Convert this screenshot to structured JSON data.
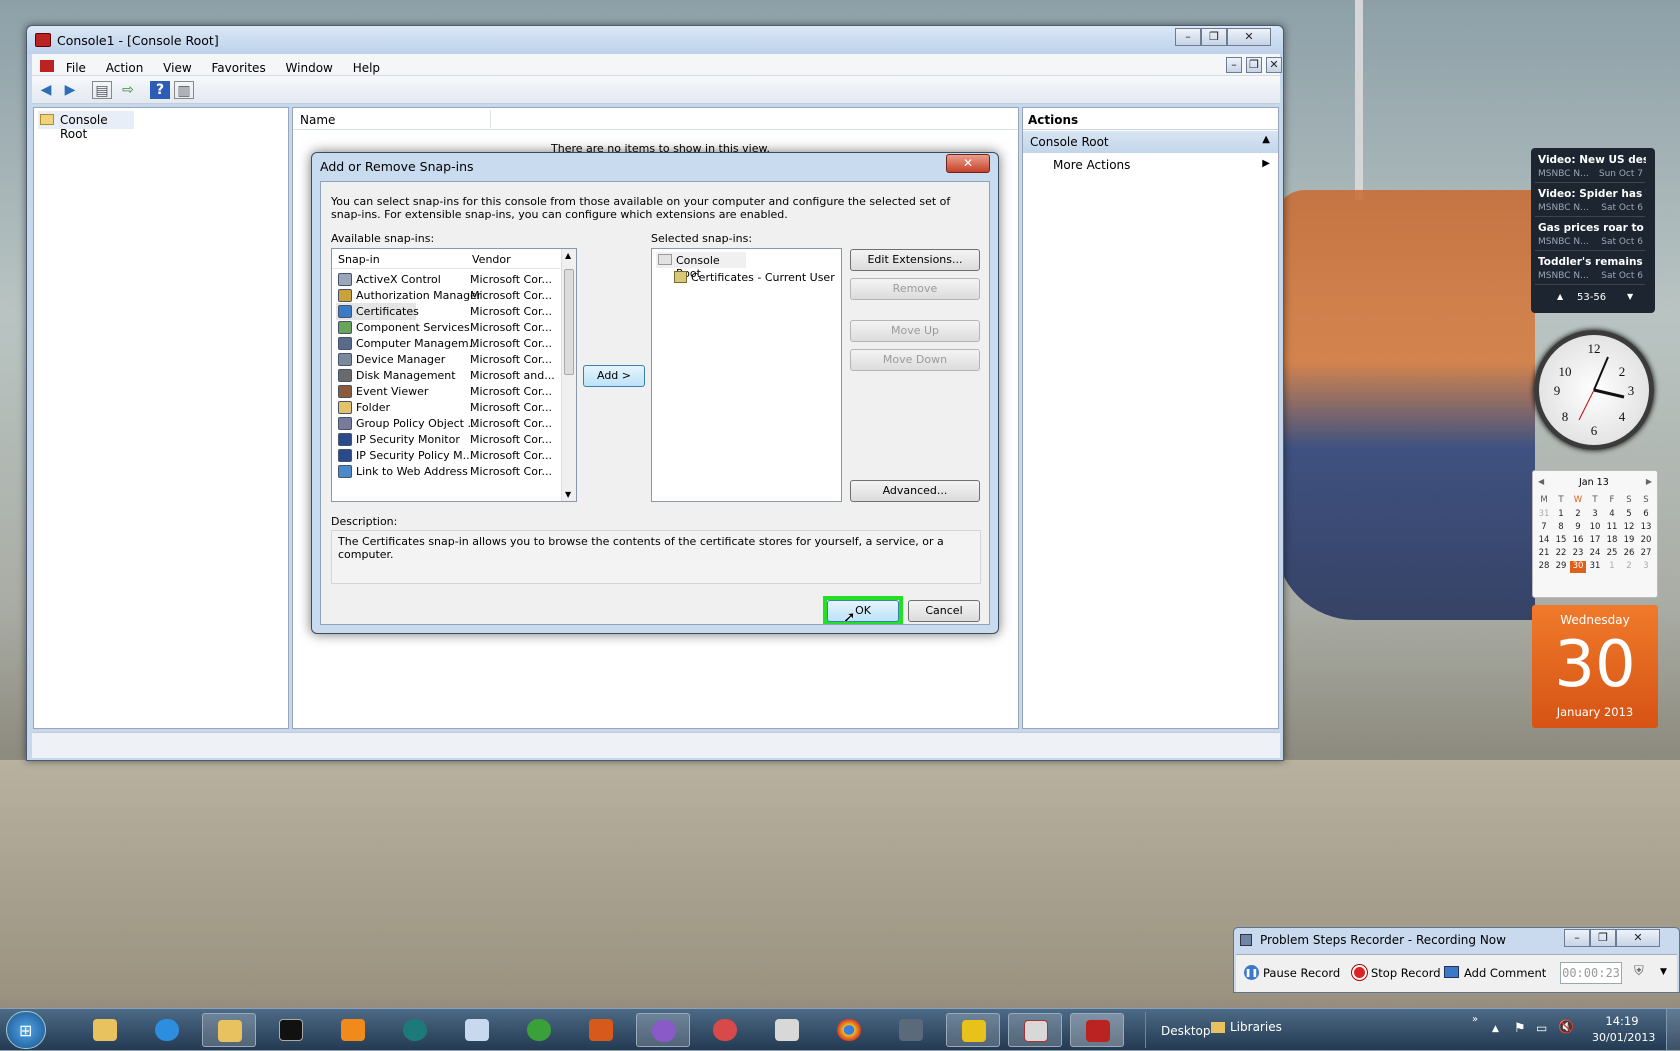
{
  "mmc": {
    "title": "Console1 - [Console Root]",
    "menu": [
      "File",
      "Action",
      "View",
      "Favorites",
      "Window",
      "Help"
    ],
    "tree_root": "Console Root",
    "list_header_name": "Name",
    "empty_text": "There are no items to show in this view.",
    "actions_header": "Actions",
    "actions_section": "Console Root",
    "actions_more": "More Actions"
  },
  "dialog": {
    "title": "Add or Remove Snap-ins",
    "close": "✕",
    "intro": "You can select snap-ins for this console from those available on your computer and configure the selected set of snap-ins. For extensible snap-ins, you can configure which extensions are enabled.",
    "available_label": "Available snap-ins:",
    "col_snapin": "Snap-in",
    "col_vendor": "Vendor",
    "snapins": [
      {
        "name": "ActiveX Control",
        "vendor": "Microsoft Cor..."
      },
      {
        "name": "Authorization Manager",
        "vendor": "Microsoft Cor..."
      },
      {
        "name": "Certificates",
        "vendor": "Microsoft Cor..."
      },
      {
        "name": "Component Services",
        "vendor": "Microsoft Cor..."
      },
      {
        "name": "Computer Managem...",
        "vendor": "Microsoft Cor..."
      },
      {
        "name": "Device Manager",
        "vendor": "Microsoft Cor..."
      },
      {
        "name": "Disk Management",
        "vendor": "Microsoft and..."
      },
      {
        "name": "Event Viewer",
        "vendor": "Microsoft Cor..."
      },
      {
        "name": "Folder",
        "vendor": "Microsoft Cor..."
      },
      {
        "name": "Group Policy Object ...",
        "vendor": "Microsoft Cor..."
      },
      {
        "name": "IP Security Monitor",
        "vendor": "Microsoft Cor..."
      },
      {
        "name": "IP Security Policy M...",
        "vendor": "Microsoft Cor..."
      },
      {
        "name": "Link to Web Address",
        "vendor": "Microsoft Cor..."
      }
    ],
    "add_button": "Add >",
    "selected_label": "Selected snap-ins:",
    "selected_root": "Console Root",
    "selected_child": "Certificates - Current User",
    "edit_extensions": "Edit Extensions...",
    "remove": "Remove",
    "move_up": "Move Up",
    "move_down": "Move Down",
    "advanced": "Advanced...",
    "description_label": "Description:",
    "description": "The Certificates snap-in allows you to browse the contents of the certificate stores for yourself, a service, or a computer.",
    "ok": "OK",
    "cancel": "Cancel"
  },
  "news_gadget": {
    "items": [
      {
        "headline": "Video: New US destr...",
        "source": "MSNBC N...",
        "date": "Sun Oct 7"
      },
      {
        "headline": "Video: Spider has Te...",
        "source": "MSNBC N...",
        "date": "Sat Oct 6"
      },
      {
        "headline": "Gas prices roar to Ca...",
        "source": "MSNBC N...",
        "date": "Sat Oct 6"
      },
      {
        "headline": "Toddler's remains fo...",
        "source": "MSNBC N...",
        "date": "Sat Oct 6"
      }
    ],
    "pager": "53-56"
  },
  "calendar": {
    "month": "Jan 13",
    "weekdays": [
      "M",
      "T",
      "W",
      "T",
      "F",
      "S",
      "S"
    ],
    "days": [
      "31",
      "1",
      "2",
      "3",
      "4",
      "5",
      "6",
      "7",
      "8",
      "9",
      "10",
      "11",
      "12",
      "13",
      "14",
      "15",
      "16",
      "17",
      "18",
      "19",
      "20",
      "21",
      "22",
      "23",
      "24",
      "25",
      "26",
      "27",
      "28",
      "29",
      "30",
      "31",
      "1",
      "2",
      "3"
    ],
    "weekday_name": "Wednesday",
    "day_number": "30",
    "month_year": "January 2013"
  },
  "recorder": {
    "title": "Problem Steps Recorder - Recording Now",
    "pause": "Pause Record",
    "stop": "Stop Record",
    "comment": "Add Comment",
    "elapsed": "00:00:23"
  },
  "taskbar": {
    "desktop": "Desktop",
    "libraries": "Libraries",
    "time": "14:19",
    "date": "30/01/2013"
  },
  "colors": {
    "highlight": "#22e022",
    "accent_orange": "#e0601a"
  }
}
